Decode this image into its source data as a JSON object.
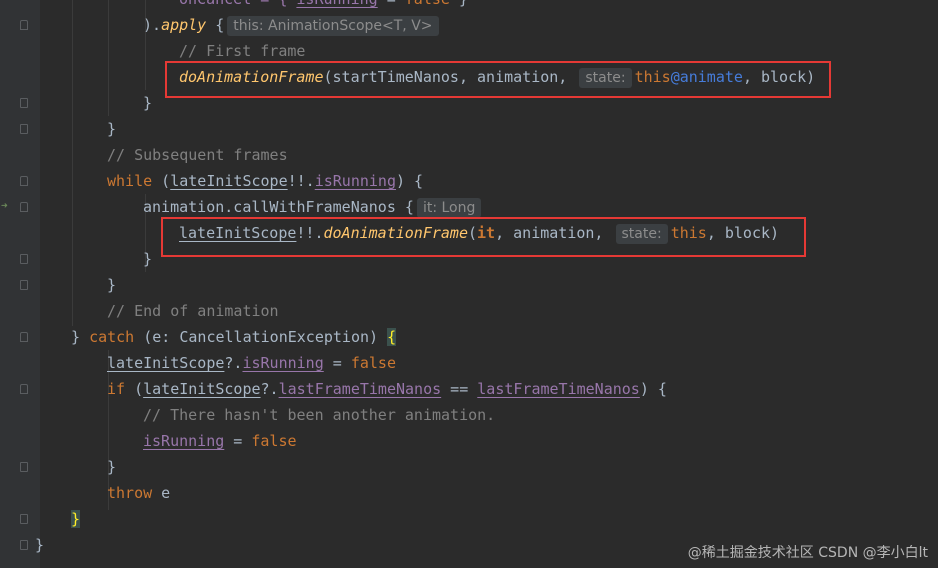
{
  "code": {
    "l0_a": "onCancel = { ",
    "l0_b": "isRunning",
    "l0_c": " = ",
    "l0_d": "false",
    "l0_e": " }",
    "l1_a": ").",
    "l1_b": "apply",
    "l1_c": " {",
    "l1_hint": "this: AnimationScope<T, V>",
    "l2": "// First frame",
    "l3_fn": "doAnimationFrame",
    "l3_a": "(startTimeNanos, animation, ",
    "l3_hint": "state:",
    "l3_this": "this",
    "l3_label": "@animate",
    "l3_b": ", block)",
    "l4": "}",
    "l5": "}",
    "l6": "// Subsequent frames",
    "l7_kw": "while",
    "l7_a": " (",
    "l7_b": "lateInitScope",
    "l7_c": "!!.",
    "l7_d": "isRunning",
    "l7_e": ") {",
    "l8_a": "animation.callWithFrameNanos {",
    "l8_hint": "it: Long",
    "l9_a": "lateInitScope",
    "l9_b": "!!.",
    "l9_fn": "doAnimationFrame",
    "l9_c": "(",
    "l9_it": "it",
    "l9_d": ", animation, ",
    "l9_hint": "state:",
    "l9_this": "this",
    "l9_e": ", block)",
    "l10": "}",
    "l11": "}",
    "l12": "// End of animation",
    "l13_a": "} ",
    "l13_kw": "catch",
    "l13_b": " (e: CancellationException) ",
    "l13_brace": "{",
    "l14_a": "lateInitScope",
    "l14_b": "?.",
    "l14_c": "isRunning",
    "l14_d": " = ",
    "l14_e": "false",
    "l15_kw": "if",
    "l15_a": " (",
    "l15_b": "lateInitScope",
    "l15_c": "?.",
    "l15_d": "lastFrameTimeNanos",
    "l15_e": " == ",
    "l15_f": "lastFrameTimeNanos",
    "l15_g": ") {",
    "l16": "// There hasn't been another animation.",
    "l17_a": "isRunning",
    "l17_b": " = ",
    "l17_c": "false",
    "l18": "}",
    "l19_kw": "throw",
    "l19_a": " e",
    "l20": "}",
    "l21": "}"
  },
  "watermark": "@稀土掘金技术社区 CSDN @李小白lt",
  "colors": {
    "background": "#2b2b2b",
    "keyword": "#cc7832",
    "comment": "#808080",
    "function": "#ffc66d",
    "property": "#9876aa",
    "highlight_box": "#e53935"
  }
}
